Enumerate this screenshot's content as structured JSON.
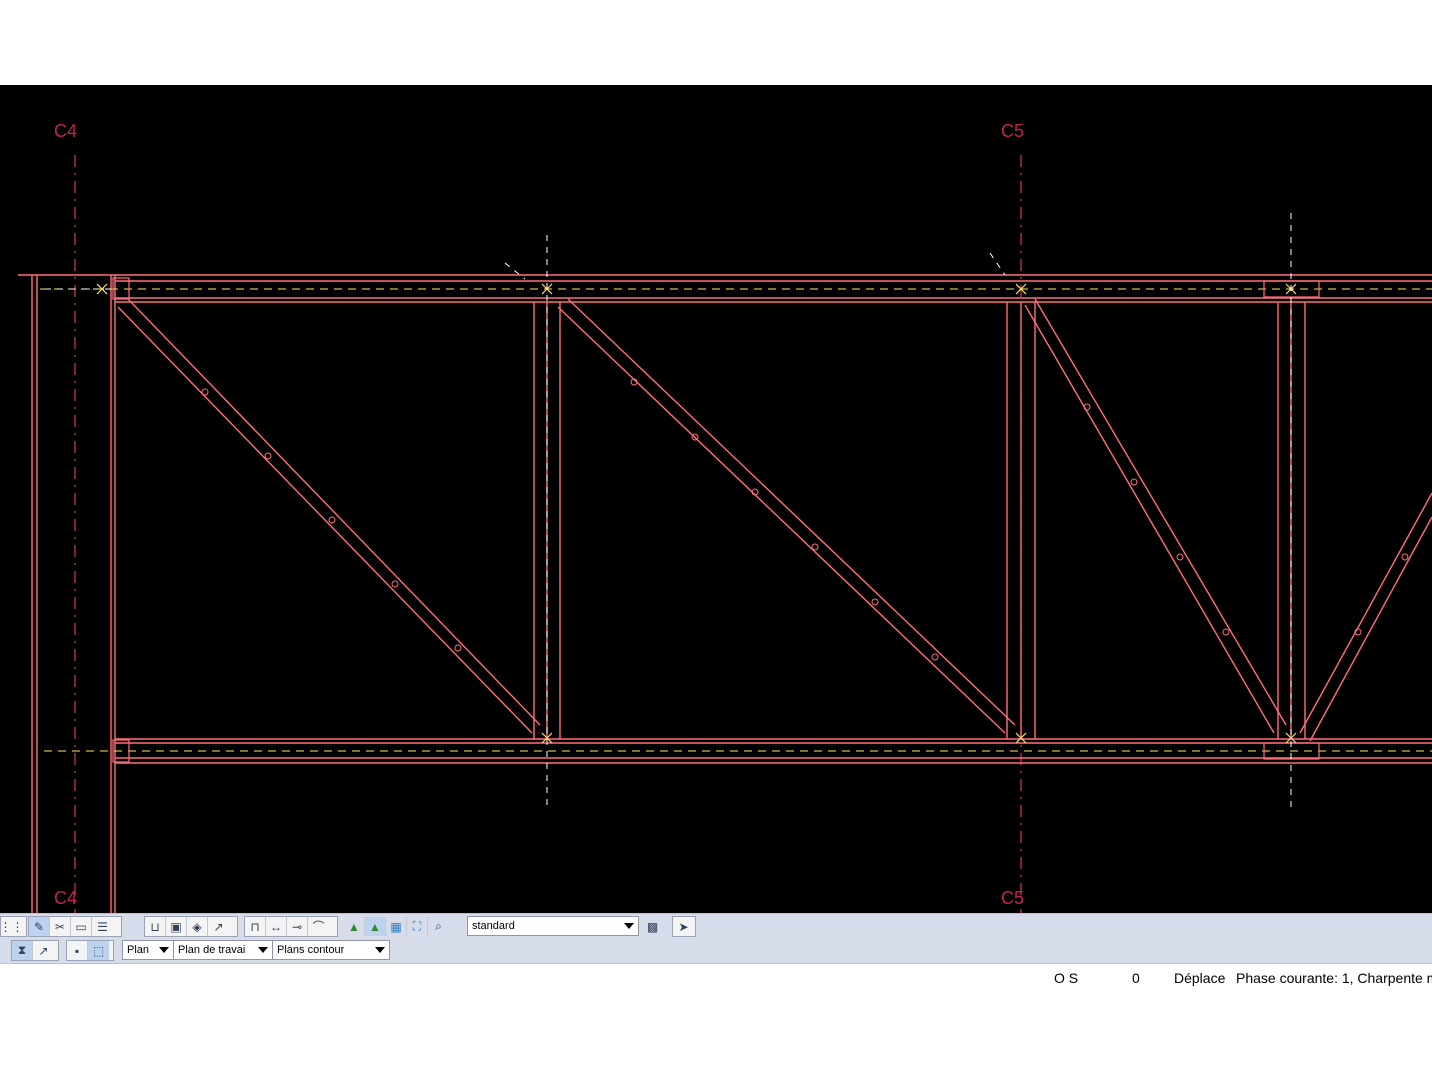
{
  "colors": {
    "member": "#ff6f7a",
    "axis_line": "#d4365a",
    "grid_label": "#c0254a",
    "node_mark": "#ffe36a",
    "guide": "#ffffff",
    "canvas_bg": "#000000",
    "toolbar_bg": "#d6dcea"
  },
  "drawing": {
    "grid_labels": {
      "c4_top": "C4",
      "c5_top": "C5",
      "c4_bottom": "C4",
      "c5_bottom": "C5"
    }
  },
  "toolbar_row1": {
    "icons": [
      "grid-dots-icon",
      "measure-icon",
      "cut-icon",
      "window-icon",
      "section-icon",
      "profile-u-icon",
      "profile-box-icon",
      "layers-icon",
      "rotate-icon",
      "frame-icon",
      "beam-icon",
      "connection-icon",
      "arch-icon",
      "green-tool-icon",
      "green-tool-2-icon",
      "select-box-icon",
      "zoom-extents-icon",
      "zoom-icon"
    ],
    "style_select": "standard",
    "extra_icons": [
      "pattern-icon",
      "pointer-icon"
    ]
  },
  "toolbar_row2": {
    "icons": [
      "hourglass-icon",
      "arrow-icon",
      "view-single-icon",
      "view-frame-icon"
    ],
    "plan_select": "Plan",
    "work_plane_select": "Plan de travai",
    "contour_select": "Plans contour"
  },
  "status": {
    "os": "O S",
    "count": "0",
    "action": "Déplace",
    "phase": "Phase courante: 1, Charpente m"
  }
}
